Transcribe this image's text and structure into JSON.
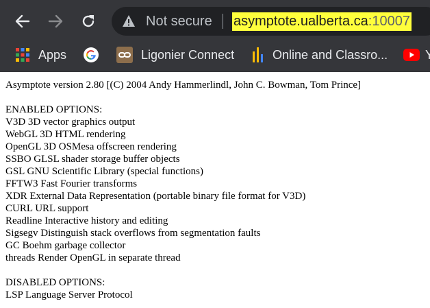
{
  "browser": {
    "not_secure_label": "Not secure",
    "url_host": "asymptote.ualberta.ca",
    "url_port": ":10007",
    "highlight_color": "#ffff3c"
  },
  "bookmarks": [
    {
      "label": "Apps",
      "icon": "apps-grid-icon"
    },
    {
      "label": "",
      "icon": "google-icon"
    },
    {
      "label": "Ligonier Connect",
      "icon": "ligonier-icon"
    },
    {
      "label": "Online and Classro...",
      "icon": "bookmark-bars-icon"
    },
    {
      "label": "Y",
      "icon": "youtube-icon"
    }
  ],
  "page": {
    "version_line": "Asymptote version 2.80 [(C) 2004 Andy Hammerlindl, John C. Bowman, Tom Prince]",
    "enabled_heading": "ENABLED OPTIONS:",
    "enabled": [
      "V3D 3D vector graphics output",
      "WebGL 3D HTML rendering",
      "OpenGL 3D OSMesa offscreen rendering",
      "SSBO GLSL shader storage buffer objects",
      "GSL GNU Scientific Library (special functions)",
      "FFTW3 Fast Fourier transforms",
      "XDR External Data Representation (portable binary file format for V3D)",
      "CURL URL support",
      "Readline Interactive history and editing",
      "Sigsegv Distinguish stack overflows from segmentation faults",
      "GC Boehm garbage collector",
      "threads Render OpenGL in separate thread"
    ],
    "disabled_heading": "DISABLED OPTIONS:",
    "disabled": [
      "LSP Language Server Protocol"
    ]
  }
}
